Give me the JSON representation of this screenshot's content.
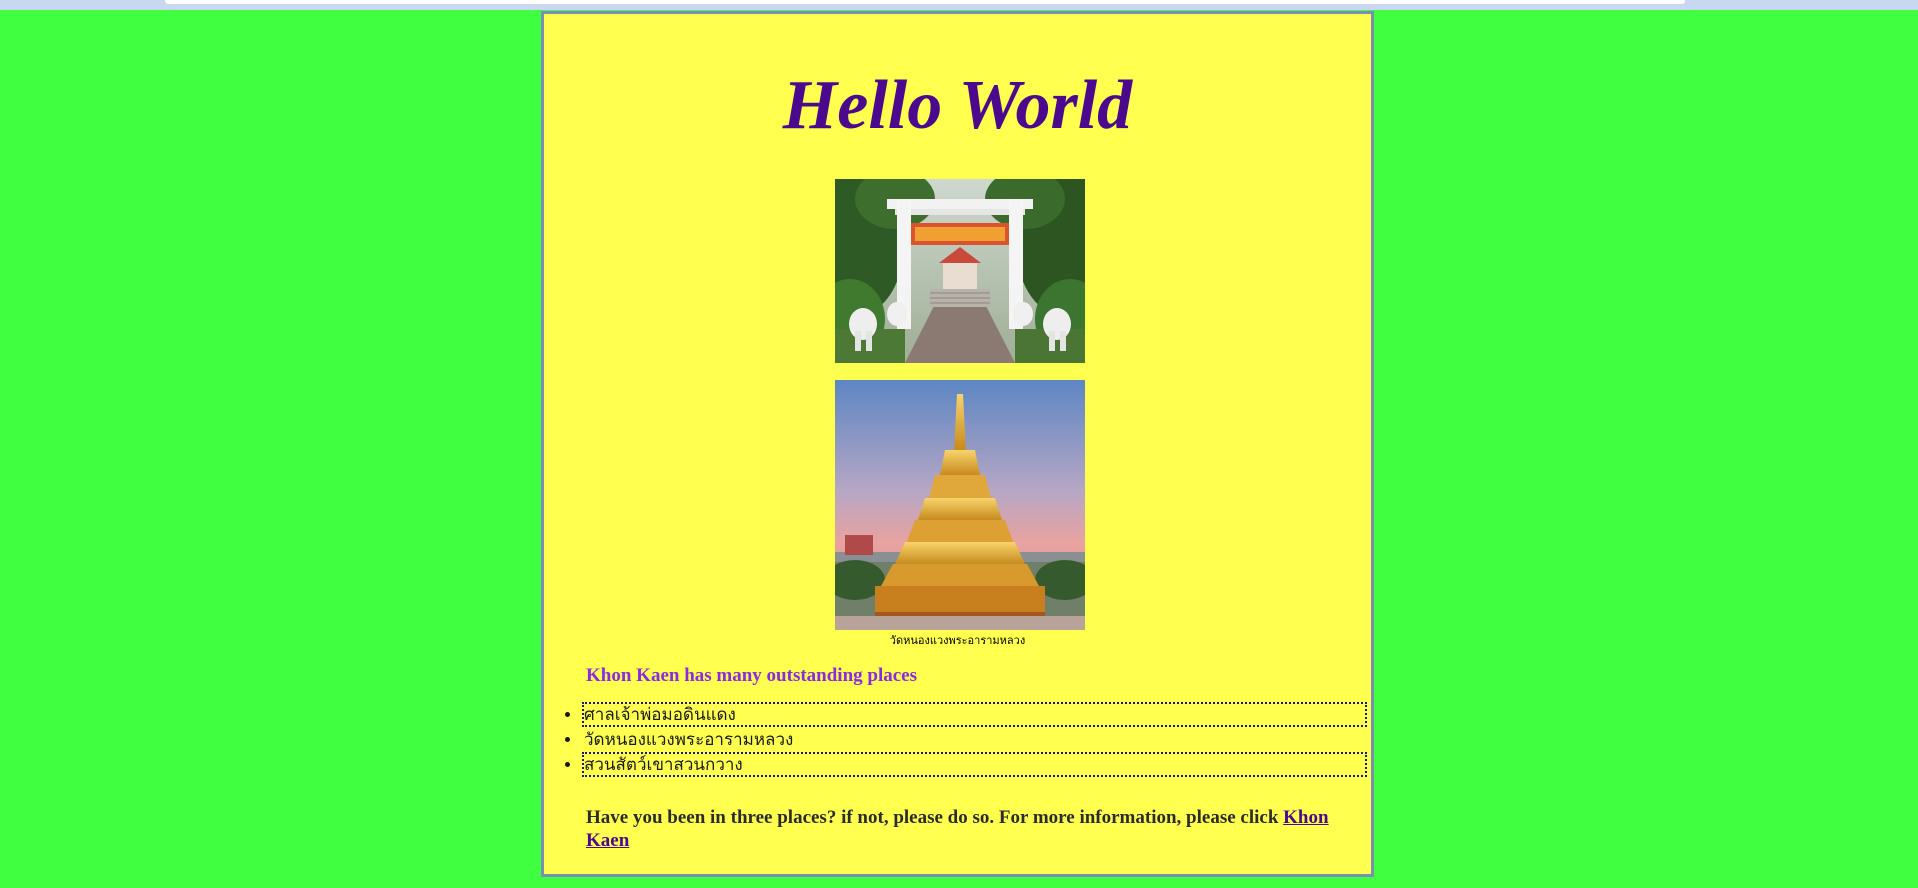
{
  "page": {
    "title": "Hello World",
    "caption": "วัดหนองแวงพระอารามหลวง",
    "subheading": "Khon Kaen has many outstanding places",
    "places": [
      "ศาลเจ้าพ่อมอดินแดง",
      "วัดหนองแวงพระอารามหลวง",
      "สวนสัตว์เขาสวนกวาง"
    ],
    "info_text": "Have you been in three places? if not, please do so. For more information, please click ",
    "info_link": "Khon Kaen"
  },
  "colors": {
    "background": "#40ff40",
    "card": "#ffff4f",
    "title": "#4b0a8e",
    "subheading": "#8a2be2"
  }
}
